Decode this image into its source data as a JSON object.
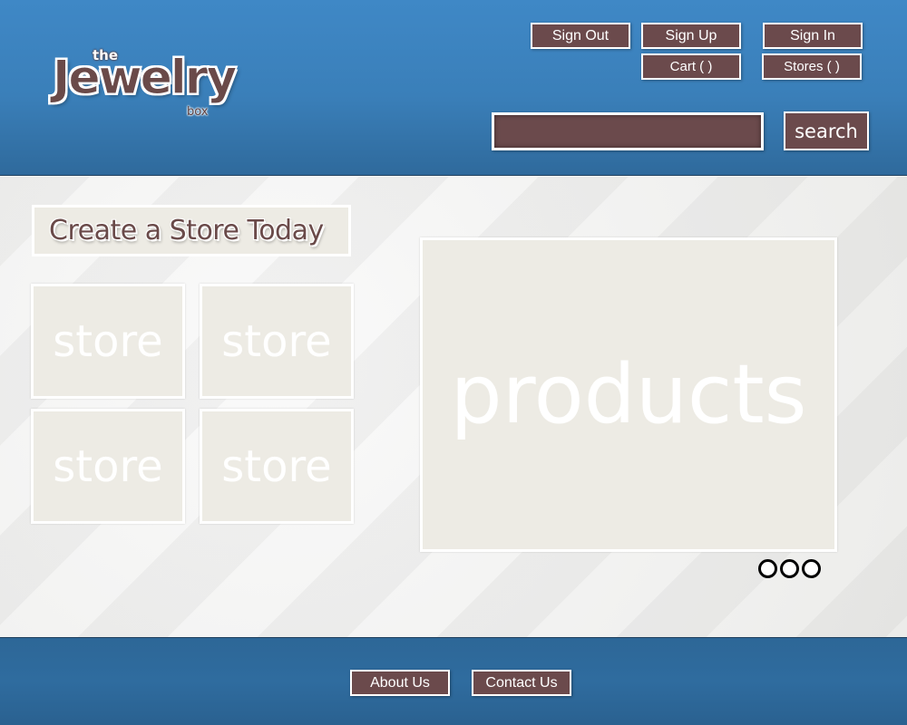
{
  "brand": {
    "logo_the": "the",
    "logo_main": "Jewelry",
    "logo_box": "box"
  },
  "header": {
    "buttons": {
      "sign_out": "Sign Out",
      "sign_up": "Sign Up",
      "sign_in": "Sign In",
      "cart": "Cart ( )",
      "stores": "Stores ( )"
    },
    "search": {
      "value": "",
      "button_label": "search"
    }
  },
  "main": {
    "create_store_title": "Create a Store Today",
    "stores": [
      "store",
      "store",
      "store",
      "store"
    ],
    "products_label": "products",
    "carousel_dots": 3
  },
  "footer": {
    "about": "About Us",
    "contact": "Contact Us"
  },
  "colors": {
    "header_blue": "#3a7fb9",
    "button_brown": "#6b4a4c",
    "tile_beige": "#edebe4"
  }
}
